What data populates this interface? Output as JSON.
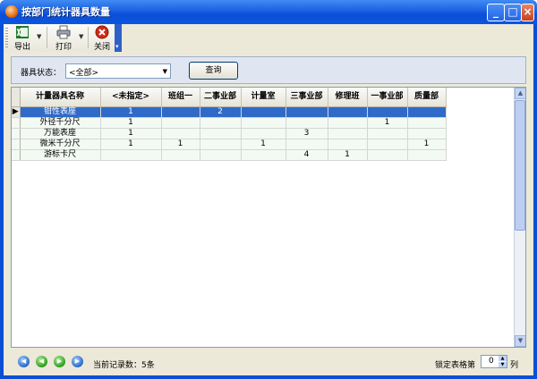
{
  "window": {
    "title": "按部门统计器具数量",
    "controls": [
      "_",
      "□",
      "×"
    ]
  },
  "toolbar": {
    "export_label": "导出",
    "print_label": "打印",
    "close_label": "关闭"
  },
  "filter": {
    "label": "器具状态：",
    "value": "<全部>",
    "query_label": "查询"
  },
  "table": {
    "headers": [
      "计量器具名称",
      "<未指定>",
      "班组一",
      "二事业部",
      "计量室",
      "三事业部",
      "修理班",
      "一事业部",
      "质量部"
    ],
    "rows": [
      [
        "钳性表座",
        "1",
        "",
        "2",
        "",
        "",
        "",
        "",
        ""
      ],
      [
        "外径千分尺",
        "1",
        "",
        "",
        "",
        "",
        "",
        "1",
        ""
      ],
      [
        "万能表座",
        "1",
        "",
        "",
        "",
        "3",
        "",
        "",
        ""
      ],
      [
        "微米千分尺",
        "1",
        "1",
        "",
        "1",
        "",
        "",
        "",
        "1"
      ],
      [
        "游标卡尺",
        "",
        "",
        "",
        "",
        "4",
        "1",
        "",
        ""
      ]
    ],
    "selected_row": 0
  },
  "status": {
    "record_count": "当前记录数：5条",
    "lock_label": "锁定表格第",
    "lock_value": "0",
    "lock_unit": "列"
  }
}
